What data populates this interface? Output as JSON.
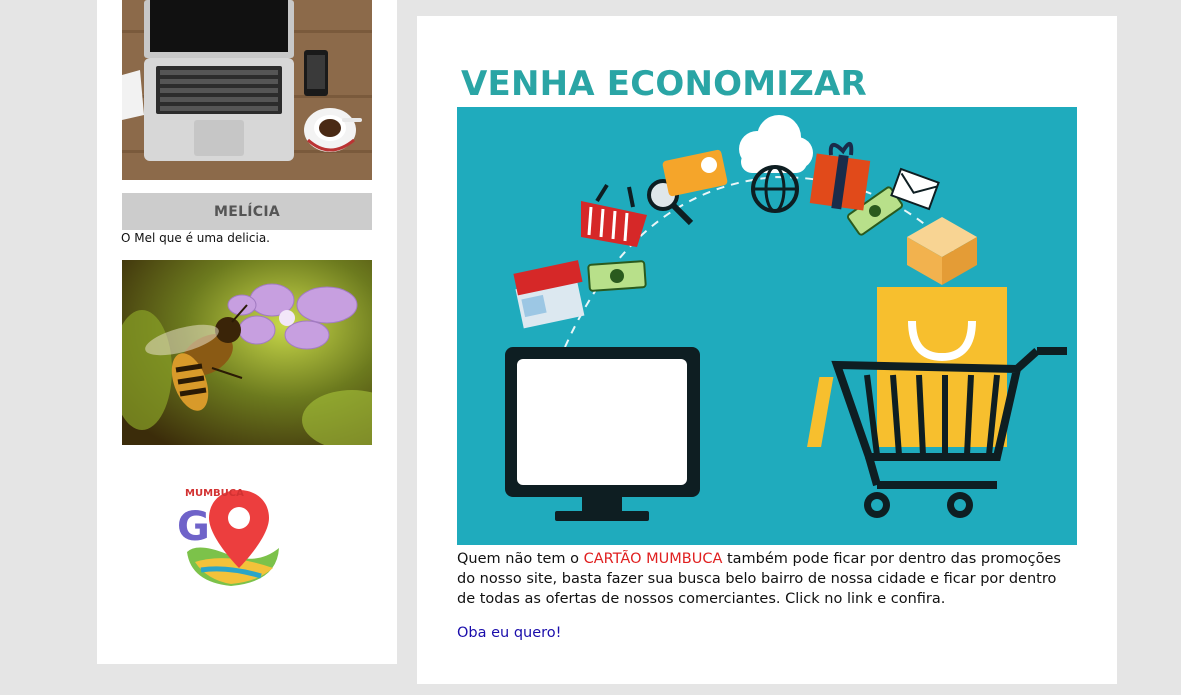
{
  "sidebar": {
    "laptop_image_alt": "laptop-on-desk-photo",
    "melicia_title": "MELÍCIA",
    "melicia_caption": "O Mel que é uma delicia.",
    "bee_image_alt": "bee-on-flower-photo",
    "logo_text": "MUMBUCA",
    "logo_letter": "G"
  },
  "main": {
    "title": "VENHA ECONOMIZAR",
    "hero_image_alt": "online-shopping-illustration",
    "body_prefix": "Quem não tem o ",
    "body_highlight": "CARTÃO MUMBUCA",
    "body_suffix": " também pode ficar por dentro das promoções do nosso site, basta fazer sua busca belo bairro de nossa cidade e ficar por dentro de todas as ofertas de nossos comerciantes. Click no link e confira.",
    "cta_link": "Oba eu quero!"
  },
  "colors": {
    "title": "#2aa5a5",
    "hero_background": "#1fabbd",
    "highlight": "#e02020",
    "link": "#1a0dab",
    "page_background": "#e5e5e5"
  }
}
